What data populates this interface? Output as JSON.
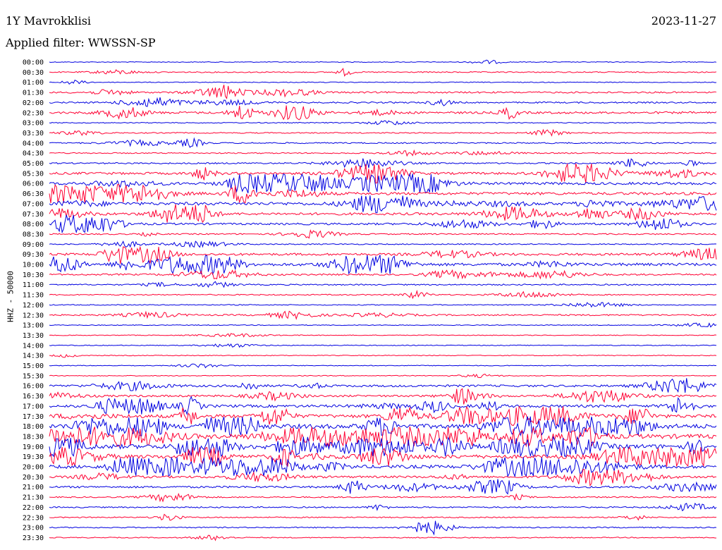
{
  "header": {
    "station": "1Y Mavrokklisi",
    "date": "2023-11-27",
    "filter_text": "Applied filter: WWSSN-SP"
  },
  "axis": {
    "ylabel": "HHZ - 50000"
  },
  "colors": {
    "trace_a": "#0000e0",
    "trace_b": "#ff0033",
    "background": "#ffffff"
  },
  "chart_data": {
    "type": "line",
    "title": "1Y Mavrokklisi",
    "ylabel": "HHZ - 50000",
    "row_labels": [
      "00:00",
      "00:30",
      "01:00",
      "01:30",
      "02:00",
      "02:30",
      "03:00",
      "03:30",
      "04:00",
      "04:30",
      "05:00",
      "05:30",
      "06:00",
      "06:30",
      "07:00",
      "07:30",
      "08:00",
      "08:30",
      "09:00",
      "09:30",
      "10:00",
      "10:30",
      "11:00",
      "11:30",
      "12:00",
      "12:30",
      "13:00",
      "13:30",
      "14:00",
      "14:30",
      "15:00",
      "15:30",
      "16:00",
      "16:30",
      "17:00",
      "17:30",
      "18:00",
      "18:30",
      "19:00",
      "19:30",
      "20:00",
      "20:30",
      "21:00",
      "21:30",
      "22:00",
      "22:30",
      "23:00",
      "23:30"
    ],
    "row_activity": [
      0.1,
      0.3,
      0.1,
      0.6,
      0.5,
      0.9,
      0.2,
      0.3,
      0.4,
      0.3,
      0.5,
      1.0,
      1.1,
      1.2,
      1.4,
      1.1,
      0.8,
      0.4,
      0.3,
      1.0,
      1.3,
      0.6,
      0.4,
      0.3,
      0.2,
      0.5,
      0.1,
      0.1,
      0.1,
      0.1,
      0.1,
      0.1,
      0.9,
      0.8,
      1.2,
      1.6,
      2.2,
      2.2,
      2.2,
      1.8,
      1.6,
      0.9,
      0.8,
      0.4,
      0.4,
      0.3,
      0.3,
      0.2
    ],
    "series": [
      {
        "color": "#0000e0",
        "rows": "even"
      },
      {
        "color": "#ff0033",
        "rows": "odd"
      }
    ]
  }
}
